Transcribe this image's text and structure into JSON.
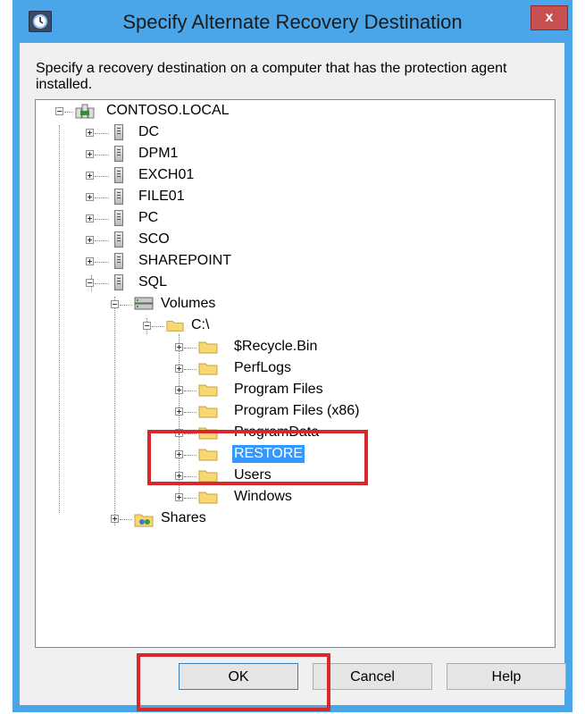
{
  "window": {
    "title": "Specify Alternate Recovery Destination",
    "close_symbol": "x",
    "app_icon": "backup-clock-icon",
    "close_color": "#c75050",
    "frame_color": "#4aa6e8"
  },
  "instruction": "Specify a recovery destination on a computer that has the protection agent installed.",
  "tree": {
    "root": {
      "label": "CONTOSO.LOCAL",
      "icon": "domain-icon",
      "expanded": true
    },
    "servers": [
      {
        "label": "DC",
        "icon": "server-icon",
        "expanded": false
      },
      {
        "label": "DPM1",
        "icon": "server-icon",
        "expanded": false
      },
      {
        "label": "EXCH01",
        "icon": "server-icon",
        "expanded": false
      },
      {
        "label": "FILE01",
        "icon": "server-icon",
        "expanded": false
      },
      {
        "label": "PC",
        "icon": "server-icon",
        "expanded": false
      },
      {
        "label": "SCO",
        "icon": "server-icon",
        "expanded": false
      },
      {
        "label": "SHAREPOINT",
        "icon": "server-icon",
        "expanded": false
      },
      {
        "label": "SQL",
        "icon": "server-icon",
        "expanded": true
      }
    ],
    "volumes": {
      "label": "Volumes",
      "icon": "drive-icon",
      "expanded": true
    },
    "drive": {
      "label": "C:\\",
      "icon": "folder-icon",
      "expanded": true
    },
    "folders": [
      {
        "label": "$Recycle.Bin",
        "icon": "folder-icon",
        "selected": false
      },
      {
        "label": "PerfLogs",
        "icon": "folder-icon",
        "selected": false
      },
      {
        "label": "Program Files",
        "icon": "folder-icon",
        "selected": false
      },
      {
        "label": "Program Files (x86)",
        "icon": "folder-icon",
        "selected": false
      },
      {
        "label": "ProgramData",
        "icon": "folder-icon",
        "selected": false
      },
      {
        "label": "RESTORE",
        "icon": "folder-icon",
        "selected": true
      },
      {
        "label": "Users",
        "icon": "folder-icon",
        "selected": false
      },
      {
        "label": "Windows",
        "icon": "folder-icon",
        "selected": false
      }
    ],
    "shares": {
      "label": "Shares",
      "icon": "shares-icon",
      "expanded": false
    },
    "selection_color": "#3399ff"
  },
  "buttons": {
    "ok": "OK",
    "cancel": "Cancel",
    "help": "Help"
  },
  "annotation_color": "#d8282b"
}
